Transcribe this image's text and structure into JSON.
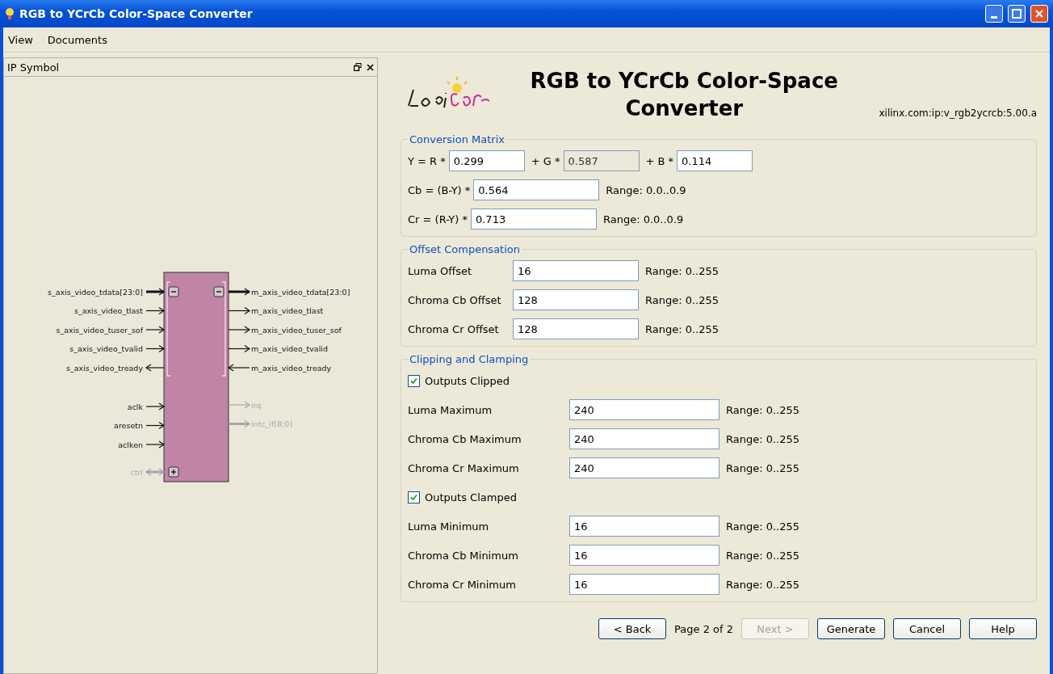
{
  "window": {
    "title": "RGB to YCrCb Color-Space Converter"
  },
  "menu": [
    {
      "label": "View"
    },
    {
      "label": "Documents"
    }
  ],
  "panel": {
    "title": "IP Symbol"
  },
  "symbol": {
    "left_groups": [
      {
        "expanded": true,
        "ports": [
          {
            "label": "s_axis_video_tdata[23:0]",
            "kind": "input",
            "bus": true,
            "disabled": false
          },
          {
            "label": "s_axis_video_tlast",
            "kind": "input",
            "bus": false,
            "disabled": false
          },
          {
            "label": "s_axis_video_tuser_sof",
            "kind": "input",
            "bus": false,
            "disabled": false
          },
          {
            "label": "s_axis_video_tvalid",
            "kind": "input",
            "bus": false,
            "disabled": false
          },
          {
            "label": "s_axis_video_tready",
            "kind": "output",
            "bus": false,
            "disabled": false
          }
        ]
      },
      {
        "ports": [
          {
            "label": "aclk",
            "kind": "input",
            "bus": false,
            "disabled": false
          },
          {
            "label": "aresetn",
            "kind": "input",
            "bus": false,
            "disabled": false
          },
          {
            "label": "aclken",
            "kind": "input",
            "bus": false,
            "disabled": false
          }
        ]
      },
      {
        "expanded": false,
        "ports": [
          {
            "label": "ctrl",
            "kind": "inout",
            "bus": true,
            "disabled": true
          }
        ]
      }
    ],
    "right_groups": [
      {
        "expanded": true,
        "ports": [
          {
            "label": "m_axis_video_tdata[23:0]",
            "kind": "output",
            "bus": true,
            "disabled": false
          },
          {
            "label": "m_axis_video_tlast",
            "kind": "output",
            "bus": false,
            "disabled": false
          },
          {
            "label": "m_axis_video_tuser_sof",
            "kind": "output",
            "bus": false,
            "disabled": false
          },
          {
            "label": "m_axis_video_tvalid",
            "kind": "output",
            "bus": false,
            "disabled": false
          },
          {
            "label": "m_axis_video_tready",
            "kind": "input",
            "bus": false,
            "disabled": false
          }
        ]
      },
      {
        "ports": [
          {
            "label": "irq",
            "kind": "output",
            "bus": false,
            "disabled": true
          },
          {
            "label": "intc_if[8:0]",
            "kind": "output",
            "bus": true,
            "disabled": true
          }
        ]
      }
    ]
  },
  "header": {
    "title": "RGB to YCrCb Color-Space Converter",
    "version": "xilinx.com:ip:v_rgb2ycrcb:5.00.a"
  },
  "conversion_matrix": {
    "title": "Conversion Matrix",
    "y_row": [
      {
        "label": "Y = R *",
        "value": "0.299",
        "disabled": false
      },
      {
        "label": "+ G *",
        "value": "0.587",
        "disabled": true
      },
      {
        "label": "+ B *",
        "value": "0.114",
        "disabled": false
      }
    ],
    "rows": [
      {
        "label": "Cb = (B-Y) *",
        "value": "0.564",
        "range": "Range: 0.0..0.9"
      },
      {
        "label": "Cr = (R-Y) *",
        "value": "0.713",
        "range": "Range: 0.0..0.9"
      }
    ]
  },
  "offset_compensation": {
    "title": "Offset Compensation",
    "rows": [
      {
        "label": "Luma Offset",
        "value": "16",
        "range": "Range: 0..255"
      },
      {
        "label": "Chroma Cb Offset",
        "value": "128",
        "range": "Range: 0..255"
      },
      {
        "label": "Chroma Cr Offset",
        "value": "128",
        "range": "Range: 0..255"
      }
    ]
  },
  "clipping_clamping": {
    "title": "Clipping and Clamping",
    "items": [
      {
        "kind": "checkbox",
        "label": "Outputs Clipped",
        "checked": true
      },
      {
        "kind": "field",
        "label": "Luma Maximum",
        "value": "240",
        "range": "Range: 0..255"
      },
      {
        "kind": "field",
        "label": "Chroma Cb Maximum",
        "value": "240",
        "range": "Range: 0..255"
      },
      {
        "kind": "field",
        "label": "Chroma Cr Maximum",
        "value": "240",
        "range": "Range: 0..255"
      },
      {
        "kind": "checkbox",
        "label": "Outputs Clamped",
        "checked": true
      },
      {
        "kind": "field",
        "label": "Luma Minimum",
        "value": "16",
        "range": "Range: 0..255"
      },
      {
        "kind": "field",
        "label": "Chroma Cb Minimum",
        "value": "16",
        "range": "Range: 0..255"
      },
      {
        "kind": "field",
        "label": "Chroma Cr Minimum",
        "value": "16",
        "range": "Range: 0..255"
      }
    ]
  },
  "footer": [
    {
      "kind": "button",
      "label": "< Back",
      "disabled": false
    },
    {
      "kind": "text",
      "label": "Page 2 of 2"
    },
    {
      "kind": "button",
      "label": "Next >",
      "disabled": true
    },
    {
      "kind": "button",
      "label": "Generate",
      "disabled": false
    },
    {
      "kind": "button",
      "label": "Cancel",
      "disabled": false
    },
    {
      "kind": "button",
      "label": "Help",
      "disabled": false
    }
  ]
}
